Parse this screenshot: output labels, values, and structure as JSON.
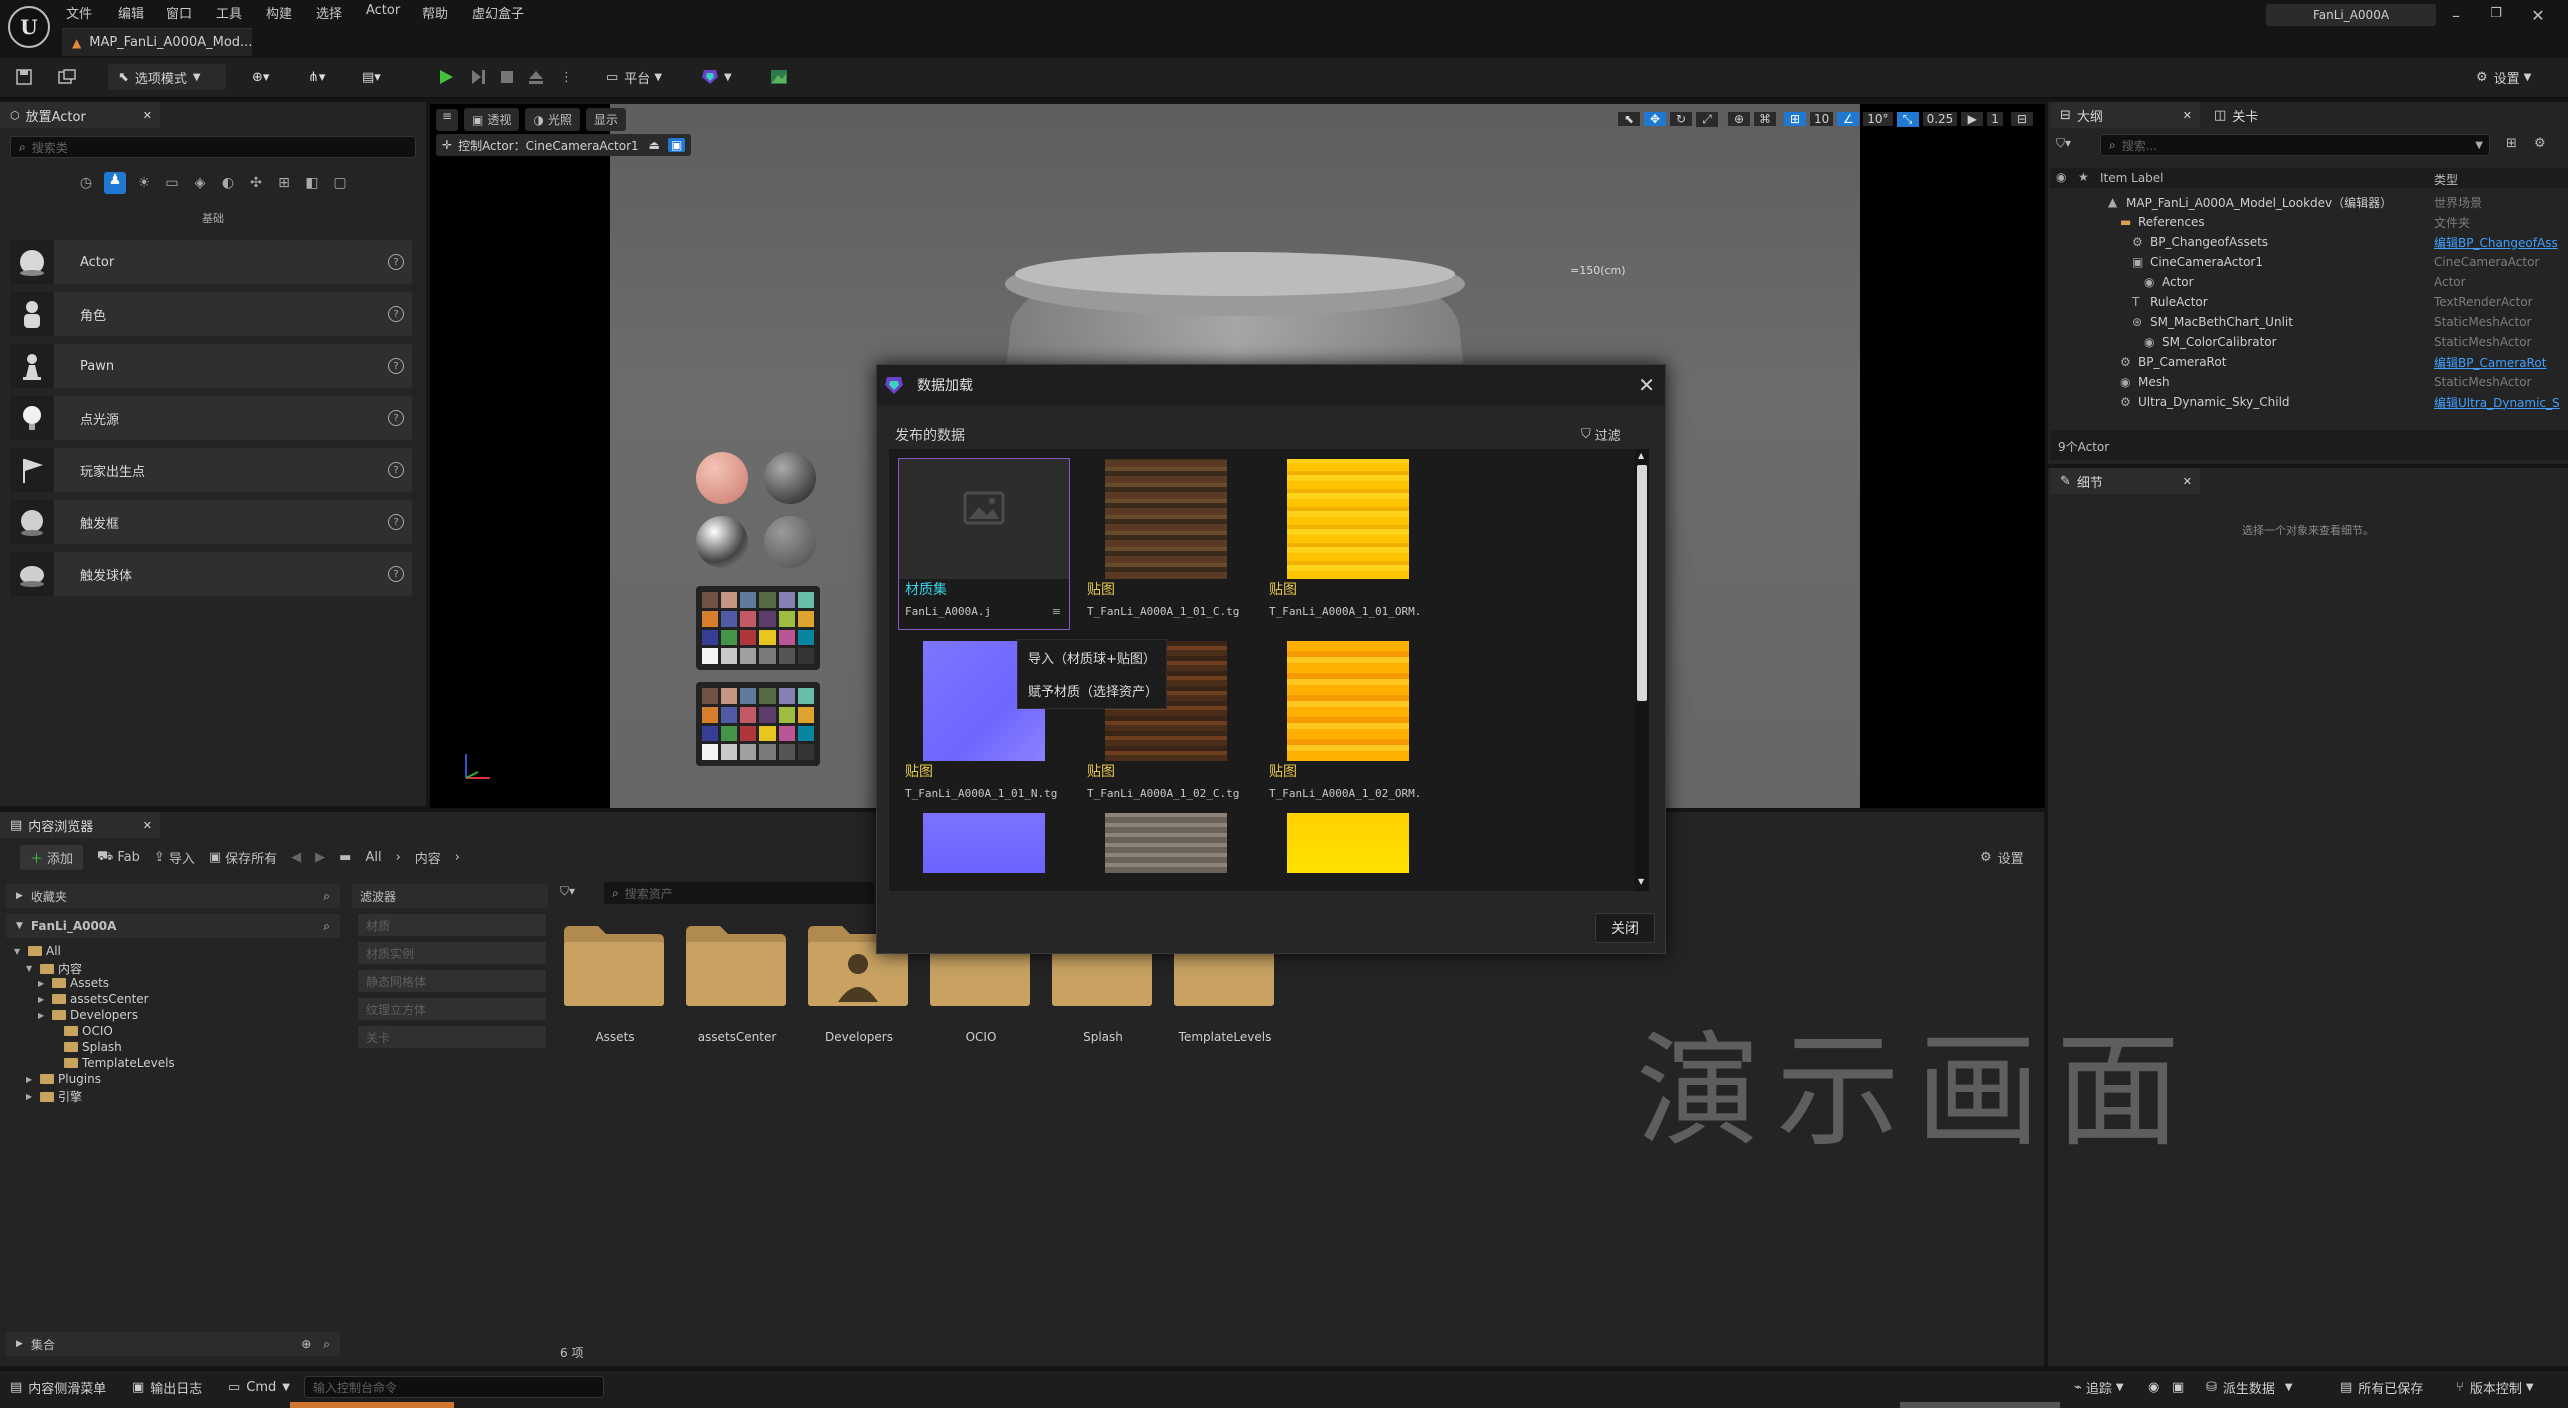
{
  "menu": [
    "文件",
    "编辑",
    "窗口",
    "工具",
    "构建",
    "选择",
    "Actor",
    "帮助",
    "虚幻盒子"
  ],
  "document_tab": "MAP_FanLi_A000A_Mod...",
  "project_name": "FanLi_A000A",
  "toolbar": {
    "select_mode": "选项模式",
    "platform": "平台",
    "settings": "设置"
  },
  "place_actors": {
    "tab": "放置Actor",
    "search_placeholder": "搜索类",
    "category": "基础",
    "items": [
      "Actor",
      "角色",
      "Pawn",
      "点光源",
      "玩家出生点",
      "触发框",
      "触发球体"
    ]
  },
  "viewport": {
    "btn_perspective": "透视",
    "btn_lit": "光照",
    "btn_show": "显示",
    "pilot_label": "控制Actor：CineCameraActor1",
    "grid_snap": "10",
    "rot_snap": "10°",
    "scale_snap": "0.25",
    "cam_speed": "1",
    "measure_text": "=150(cm)"
  },
  "dialog": {
    "title": "数据加载",
    "section": "发布的数据",
    "filter": "过滤",
    "close": "关闭",
    "cards": [
      {
        "type": "材质集",
        "file": "FanLi_A000A.j"
      },
      {
        "type": "贴图",
        "file": "T_FanLi_A000A_1_01_C.tg"
      },
      {
        "type": "贴图",
        "file": "T_FanLi_A000A_1_01_ORM."
      },
      {
        "type": "贴图",
        "file": "T_FanLi_A000A_1_01_N.tg"
      },
      {
        "type": "贴图",
        "file": "T_FanLi_A000A_1_02_C.tg"
      },
      {
        "type": "贴图",
        "file": "T_FanLi_A000A_1_02_ORM."
      }
    ],
    "context_menu": [
      "导入（材质球+贴图）",
      "赋予材质（选择资产）"
    ]
  },
  "outliner": {
    "tab": "大纲",
    "tab2": "关卡",
    "search_placeholder": "搜索...",
    "col_label": "Item Label",
    "col_type": "类型",
    "rows": [
      {
        "name": "MAP_FanLi_A000A_Model_Lookdev（编辑器）",
        "type": "世界场景"
      },
      {
        "name": "References",
        "type": "文件夹"
      },
      {
        "name": "BP_ChangeofAssets",
        "type": "编辑BP_ChangeofAss"
      },
      {
        "name": "CineCameraActor1",
        "type": "CineCameraActor"
      },
      {
        "name": "Actor",
        "type": "Actor"
      },
      {
        "name": "RuleActor",
        "type": "TextRenderActor"
      },
      {
        "name": "SM_MacBethChart_Unlit",
        "type": "StaticMeshActor"
      },
      {
        "name": "SM_ColorCalibrator",
        "type": "StaticMeshActor"
      },
      {
        "name": "BP_CameraRot",
        "type": "编辑BP_CameraRot"
      },
      {
        "name": "Mesh",
        "type": "StaticMeshActor"
      },
      {
        "name": "Ultra_Dynamic_Sky_Child",
        "type": "编辑Ultra_Dynamic_S"
      }
    ],
    "count": "9个Actor"
  },
  "details": {
    "tab": "细节",
    "empty": "选择一个对象来查看细节。"
  },
  "content_browser": {
    "tab": "内容浏览器",
    "add": "添加",
    "fab": "Fab",
    "import": "导入",
    "save_all": "保存所有",
    "path": [
      "All",
      "内容"
    ],
    "settings": "设置",
    "favorites": "收藏夹",
    "project": "FanLi_A000A",
    "tree": [
      "All",
      "内容",
      "Assets",
      "assetsCenter",
      "Developers",
      "OCIO",
      "Splash",
      "TemplateLevels",
      "Plugins",
      "引擎"
    ],
    "filters_title": "滤波器",
    "filters": [
      "材质",
      "材质实例",
      "静态网格体",
      "纹理立方体",
      "关卡"
    ],
    "search_placeholder": "搜索资产",
    "folders": [
      "Assets",
      "assetsCenter",
      "Developers",
      "OCIO",
      "Splash",
      "TemplateLevels"
    ],
    "item_count": "6 项",
    "collections": "集合"
  },
  "watermark": "演示画面",
  "statusbar": {
    "drawer": "内容侧滑菜单",
    "output_log": "输出日志",
    "cmd": "Cmd",
    "cmd_placeholder": "输入控制台命令",
    "trace": "追踪",
    "derived_data": "派生数据",
    "all_saved": "所有已保存",
    "version_control": "版本控制"
  },
  "colors": {
    "accent_blue": "#1f78d1",
    "play_green": "#45c140",
    "link_blue": "#3fa0ff",
    "card_type_yellow": "#e6c84a",
    "selected_purple": "#8a56c8"
  }
}
